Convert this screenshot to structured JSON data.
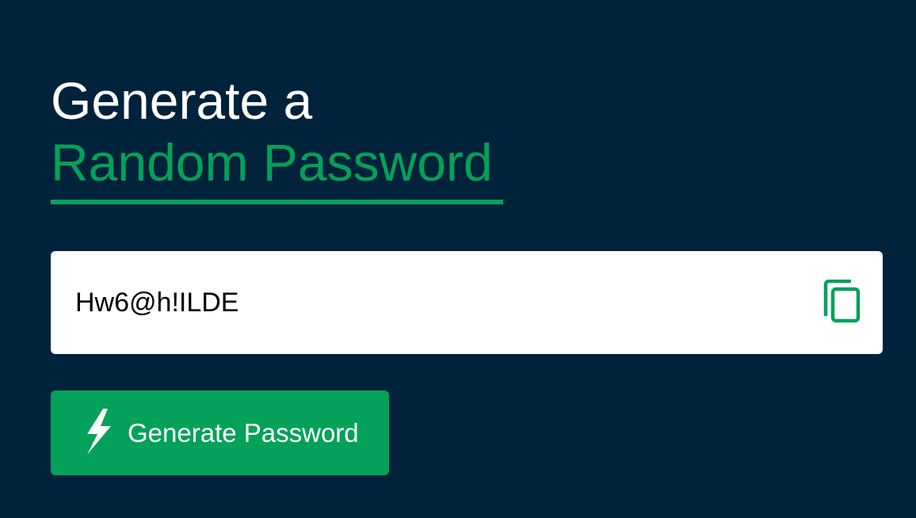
{
  "header": {
    "line1": "Generate a",
    "line2": "Random Password"
  },
  "password": {
    "value": "Hw6@h!ILDE"
  },
  "icons": {
    "copy": "copy-icon",
    "generate": "lightning-bolt-icon"
  },
  "actions": {
    "generate_label": "Generate Password"
  },
  "colors": {
    "background": "#00223a",
    "accent": "#03a15a",
    "field": "#ffffff"
  }
}
